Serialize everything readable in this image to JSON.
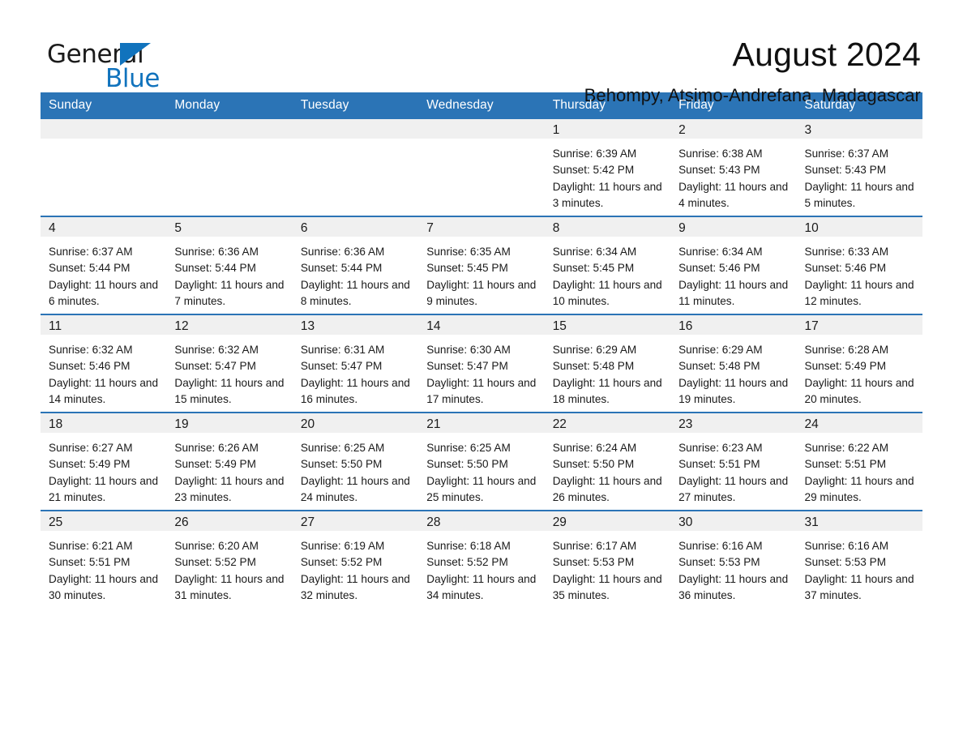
{
  "brand": {
    "name_part1": "General",
    "name_part2": "Blue",
    "accent_color": "#1173bd"
  },
  "header": {
    "month_title": "August 2024",
    "location": "Behompy, Atsimo-Andrefana, Madagascar"
  },
  "calendar": {
    "header_color": "#2b74b6",
    "weekday_headers": [
      "Sunday",
      "Monday",
      "Tuesday",
      "Wednesday",
      "Thursday",
      "Friday",
      "Saturday"
    ],
    "weeks": [
      [
        {
          "day": "",
          "sunrise": "",
          "sunset": "",
          "daylight": ""
        },
        {
          "day": "",
          "sunrise": "",
          "sunset": "",
          "daylight": ""
        },
        {
          "day": "",
          "sunrise": "",
          "sunset": "",
          "daylight": ""
        },
        {
          "day": "",
          "sunrise": "",
          "sunset": "",
          "daylight": ""
        },
        {
          "day": "1",
          "sunrise": "Sunrise: 6:39 AM",
          "sunset": "Sunset: 5:42 PM",
          "daylight": "Daylight: 11 hours and 3 minutes."
        },
        {
          "day": "2",
          "sunrise": "Sunrise: 6:38 AM",
          "sunset": "Sunset: 5:43 PM",
          "daylight": "Daylight: 11 hours and 4 minutes."
        },
        {
          "day": "3",
          "sunrise": "Sunrise: 6:37 AM",
          "sunset": "Sunset: 5:43 PM",
          "daylight": "Daylight: 11 hours and 5 minutes."
        }
      ],
      [
        {
          "day": "4",
          "sunrise": "Sunrise: 6:37 AM",
          "sunset": "Sunset: 5:44 PM",
          "daylight": "Daylight: 11 hours and 6 minutes."
        },
        {
          "day": "5",
          "sunrise": "Sunrise: 6:36 AM",
          "sunset": "Sunset: 5:44 PM",
          "daylight": "Daylight: 11 hours and 7 minutes."
        },
        {
          "day": "6",
          "sunrise": "Sunrise: 6:36 AM",
          "sunset": "Sunset: 5:44 PM",
          "daylight": "Daylight: 11 hours and 8 minutes."
        },
        {
          "day": "7",
          "sunrise": "Sunrise: 6:35 AM",
          "sunset": "Sunset: 5:45 PM",
          "daylight": "Daylight: 11 hours and 9 minutes."
        },
        {
          "day": "8",
          "sunrise": "Sunrise: 6:34 AM",
          "sunset": "Sunset: 5:45 PM",
          "daylight": "Daylight: 11 hours and 10 minutes."
        },
        {
          "day": "9",
          "sunrise": "Sunrise: 6:34 AM",
          "sunset": "Sunset: 5:46 PM",
          "daylight": "Daylight: 11 hours and 11 minutes."
        },
        {
          "day": "10",
          "sunrise": "Sunrise: 6:33 AM",
          "sunset": "Sunset: 5:46 PM",
          "daylight": "Daylight: 11 hours and 12 minutes."
        }
      ],
      [
        {
          "day": "11",
          "sunrise": "Sunrise: 6:32 AM",
          "sunset": "Sunset: 5:46 PM",
          "daylight": "Daylight: 11 hours and 14 minutes."
        },
        {
          "day": "12",
          "sunrise": "Sunrise: 6:32 AM",
          "sunset": "Sunset: 5:47 PM",
          "daylight": "Daylight: 11 hours and 15 minutes."
        },
        {
          "day": "13",
          "sunrise": "Sunrise: 6:31 AM",
          "sunset": "Sunset: 5:47 PM",
          "daylight": "Daylight: 11 hours and 16 minutes."
        },
        {
          "day": "14",
          "sunrise": "Sunrise: 6:30 AM",
          "sunset": "Sunset: 5:47 PM",
          "daylight": "Daylight: 11 hours and 17 minutes."
        },
        {
          "day": "15",
          "sunrise": "Sunrise: 6:29 AM",
          "sunset": "Sunset: 5:48 PM",
          "daylight": "Daylight: 11 hours and 18 minutes."
        },
        {
          "day": "16",
          "sunrise": "Sunrise: 6:29 AM",
          "sunset": "Sunset: 5:48 PM",
          "daylight": "Daylight: 11 hours and 19 minutes."
        },
        {
          "day": "17",
          "sunrise": "Sunrise: 6:28 AM",
          "sunset": "Sunset: 5:49 PM",
          "daylight": "Daylight: 11 hours and 20 minutes."
        }
      ],
      [
        {
          "day": "18",
          "sunrise": "Sunrise: 6:27 AM",
          "sunset": "Sunset: 5:49 PM",
          "daylight": "Daylight: 11 hours and 21 minutes."
        },
        {
          "day": "19",
          "sunrise": "Sunrise: 6:26 AM",
          "sunset": "Sunset: 5:49 PM",
          "daylight": "Daylight: 11 hours and 23 minutes."
        },
        {
          "day": "20",
          "sunrise": "Sunrise: 6:25 AM",
          "sunset": "Sunset: 5:50 PM",
          "daylight": "Daylight: 11 hours and 24 minutes."
        },
        {
          "day": "21",
          "sunrise": "Sunrise: 6:25 AM",
          "sunset": "Sunset: 5:50 PM",
          "daylight": "Daylight: 11 hours and 25 minutes."
        },
        {
          "day": "22",
          "sunrise": "Sunrise: 6:24 AM",
          "sunset": "Sunset: 5:50 PM",
          "daylight": "Daylight: 11 hours and 26 minutes."
        },
        {
          "day": "23",
          "sunrise": "Sunrise: 6:23 AM",
          "sunset": "Sunset: 5:51 PM",
          "daylight": "Daylight: 11 hours and 27 minutes."
        },
        {
          "day": "24",
          "sunrise": "Sunrise: 6:22 AM",
          "sunset": "Sunset: 5:51 PM",
          "daylight": "Daylight: 11 hours and 29 minutes."
        }
      ],
      [
        {
          "day": "25",
          "sunrise": "Sunrise: 6:21 AM",
          "sunset": "Sunset: 5:51 PM",
          "daylight": "Daylight: 11 hours and 30 minutes."
        },
        {
          "day": "26",
          "sunrise": "Sunrise: 6:20 AM",
          "sunset": "Sunset: 5:52 PM",
          "daylight": "Daylight: 11 hours and 31 minutes."
        },
        {
          "day": "27",
          "sunrise": "Sunrise: 6:19 AM",
          "sunset": "Sunset: 5:52 PM",
          "daylight": "Daylight: 11 hours and 32 minutes."
        },
        {
          "day": "28",
          "sunrise": "Sunrise: 6:18 AM",
          "sunset": "Sunset: 5:52 PM",
          "daylight": "Daylight: 11 hours and 34 minutes."
        },
        {
          "day": "29",
          "sunrise": "Sunrise: 6:17 AM",
          "sunset": "Sunset: 5:53 PM",
          "daylight": "Daylight: 11 hours and 35 minutes."
        },
        {
          "day": "30",
          "sunrise": "Sunrise: 6:16 AM",
          "sunset": "Sunset: 5:53 PM",
          "daylight": "Daylight: 11 hours and 36 minutes."
        },
        {
          "day": "31",
          "sunrise": "Sunrise: 6:16 AM",
          "sunset": "Sunset: 5:53 PM",
          "daylight": "Daylight: 11 hours and 37 minutes."
        }
      ]
    ]
  }
}
